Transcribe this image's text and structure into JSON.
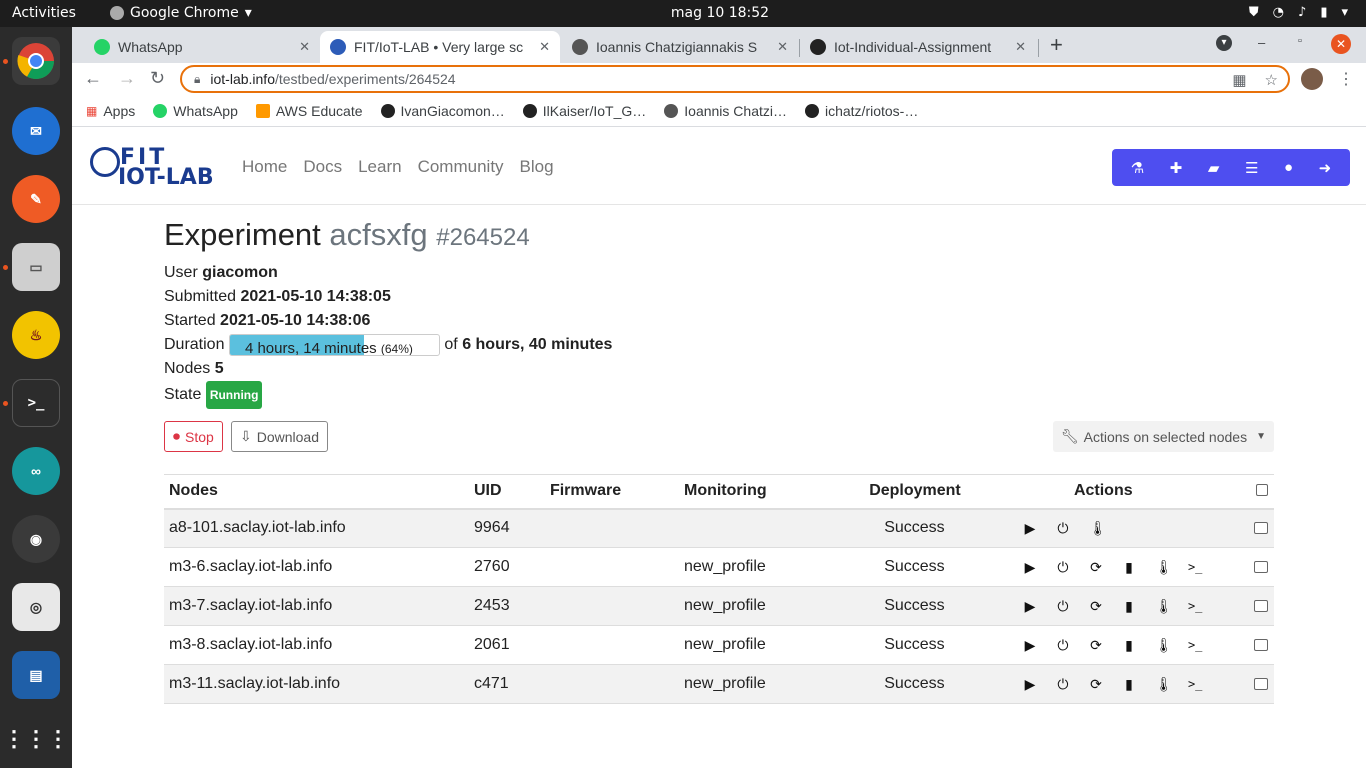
{
  "os": {
    "activities": "Activities",
    "app_menu": "Google Chrome",
    "clock": "mag 10  18:52"
  },
  "browser": {
    "tabs": [
      {
        "title": "WhatsApp",
        "favicon_color": "#25d366"
      },
      {
        "title": "FIT/IoT-LAB • Very large sc",
        "favicon_color": "#2d5cb8"
      },
      {
        "title": "Ioannis Chatzigiannakis S",
        "favicon_color": "#555555"
      },
      {
        "title": "Iot-Individual-Assignment",
        "favicon_color": "#222222"
      }
    ],
    "url_host": "iot-lab.info",
    "url_path": "/testbed/experiments/264524",
    "bookmarks": [
      {
        "label": "Apps",
        "color": "#ea4335"
      },
      {
        "label": "WhatsApp",
        "color": "#25d366"
      },
      {
        "label": "AWS Educate",
        "color": "#ff9900"
      },
      {
        "label": "IvanGiacomon…",
        "color": "#222222"
      },
      {
        "label": "IlKaiser/IoT_G…",
        "color": "#222222"
      },
      {
        "label": "Ioannis Chatzi…",
        "color": "#555555"
      },
      {
        "label": "ichatz/riotos-…",
        "color": "#222222"
      }
    ]
  },
  "nav": {
    "logo_top": "FIT",
    "logo_bottom": "IOT-LAB",
    "links": [
      "Home",
      "Docs",
      "Learn",
      "Community",
      "Blog"
    ],
    "user_icons": [
      "flask-icon",
      "plus-icon",
      "folder-icon",
      "server-icon",
      "user-icon",
      "logout-icon"
    ]
  },
  "experiment": {
    "heading": "Experiment",
    "name": "acfsxfg",
    "id": "#264524",
    "user_label": "User",
    "user": "giacomon",
    "submitted_label": "Submitted",
    "submitted": "2021-05-10 14:38:05",
    "started_label": "Started",
    "started": "2021-05-10 14:38:06",
    "duration_label": "Duration",
    "elapsed": "4 hours, 14 minutes",
    "percent": "(64%)",
    "progress_fraction": 0.64,
    "of_label": "of",
    "total": "6 hours, 40 minutes",
    "nodes_label": "Nodes",
    "nodes": "5",
    "state_label": "State",
    "state": "Running"
  },
  "buttons": {
    "stop": "Stop",
    "download": "Download",
    "actions": "Actions on selected nodes"
  },
  "table": {
    "headers": [
      "Nodes",
      "UID",
      "Firmware",
      "Monitoring",
      "Deployment",
      "Actions"
    ],
    "rows": [
      {
        "node": "a8-101.saclay.iot-lab.info",
        "uid": "9964",
        "firmware": "",
        "monitoring": "",
        "deployment": "Success",
        "actions": [
          "play",
          "power",
          "thermometer"
        ]
      },
      {
        "node": "m3-6.saclay.iot-lab.info",
        "uid": "2760",
        "firmware": "",
        "monitoring": "new_profile",
        "deployment": "Success",
        "actions": [
          "play",
          "power",
          "refresh",
          "chip",
          "thermometer",
          "terminal"
        ]
      },
      {
        "node": "m3-7.saclay.iot-lab.info",
        "uid": "2453",
        "firmware": "",
        "monitoring": "new_profile",
        "deployment": "Success",
        "actions": [
          "play",
          "power",
          "refresh",
          "chip",
          "thermometer",
          "terminal"
        ]
      },
      {
        "node": "m3-8.saclay.iot-lab.info",
        "uid": "2061",
        "firmware": "",
        "monitoring": "new_profile",
        "deployment": "Success",
        "actions": [
          "play",
          "power",
          "refresh",
          "chip",
          "thermometer",
          "terminal"
        ]
      },
      {
        "node": "m3-11.saclay.iot-lab.info",
        "uid": "c471",
        "firmware": "",
        "monitoring": "new_profile",
        "deployment": "Success",
        "actions": [
          "play",
          "power",
          "refresh",
          "chip",
          "thermometer",
          "terminal"
        ]
      }
    ]
  }
}
